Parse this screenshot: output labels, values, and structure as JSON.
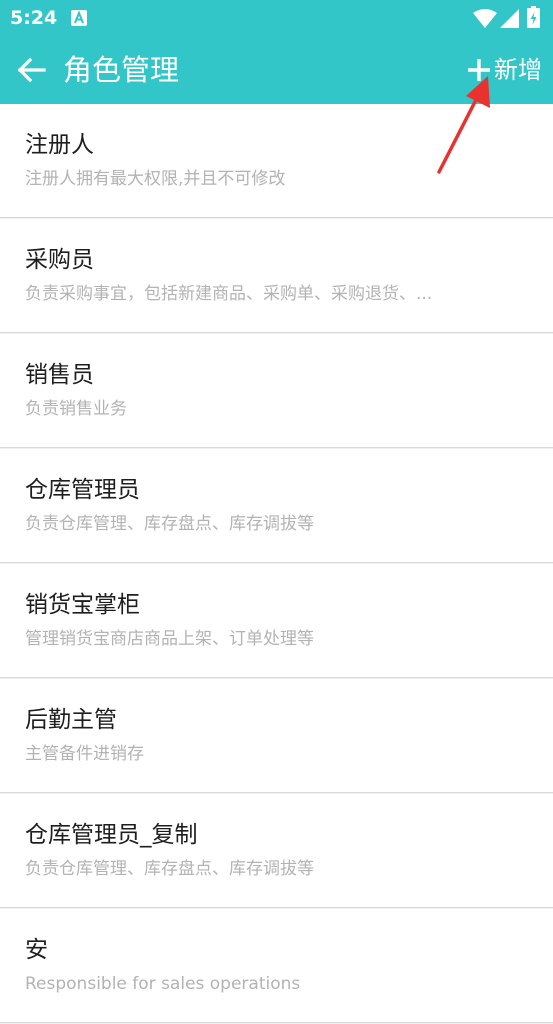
{
  "status_bar": {
    "time": "5:24"
  },
  "header": {
    "title": "角色管理",
    "add_label": "新增"
  },
  "roles": [
    {
      "name": "注册人",
      "description": "注册人拥有最大权限,并且不可修改"
    },
    {
      "name": "采购员",
      "description": "负责采购事宜，包括新建商品、采购单、采购退货、..."
    },
    {
      "name": "销售员",
      "description": "负责销售业务"
    },
    {
      "name": "仓库管理员",
      "description": "负责仓库管理、库存盘点、库存调拔等"
    },
    {
      "name": "销货宝掌柜",
      "description": "管理销货宝商店商品上架、订单处理等"
    },
    {
      "name": "后勤主管",
      "description": "主管备件进销存"
    },
    {
      "name": "仓库管理员_复制",
      "description": "负责仓库管理、库存盘点、库存调拔等"
    },
    {
      "name": "安",
      "description": "Responsible for sales operations"
    }
  ],
  "colors": {
    "accent": "#33c6c9",
    "annotation": "#e8322f"
  },
  "icons": {
    "back": "arrow-left-icon",
    "add": "plus-icon",
    "wifi": "wifi-icon",
    "signal": "signal-icon",
    "battery": "battery-icon",
    "notification": "notification-a-icon"
  }
}
